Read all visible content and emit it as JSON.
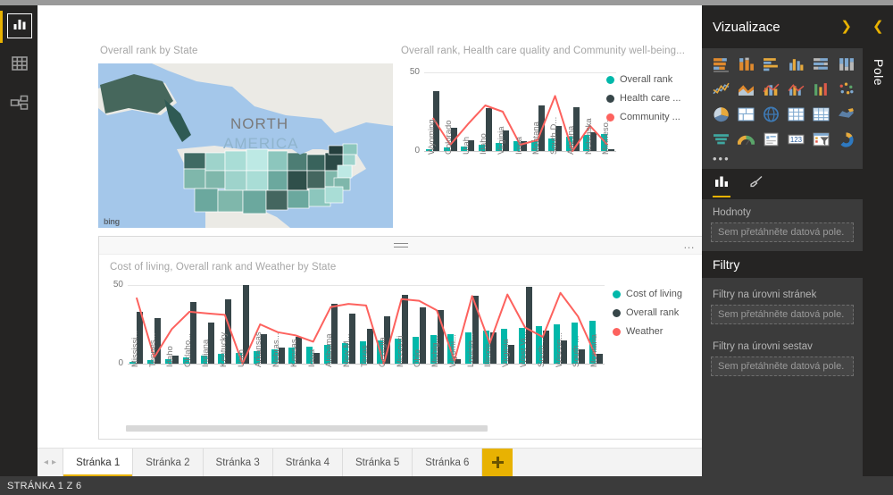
{
  "app": {
    "left_rail": [
      {
        "name": "report-view",
        "icon": "bar-chart-icon",
        "active": true
      },
      {
        "name": "data-view",
        "icon": "table-icon",
        "active": false
      },
      {
        "name": "model-view",
        "icon": "relationships-icon",
        "active": false
      }
    ]
  },
  "map_visual": {
    "title": "Overall rank by State",
    "attribution": "bing",
    "region_label_1": "NORTH",
    "region_label_2": "AMERICA"
  },
  "combo_top": {
    "title": "Overall rank, Health care quality and Community well-being...",
    "legend": [
      {
        "label": "Overall rank",
        "color": "#01b8aa"
      },
      {
        "label": "Health care ...",
        "color": "#374649"
      },
      {
        "label": "Community ...",
        "color": "#fd625e"
      }
    ]
  },
  "combo_bottom": {
    "title": "Cost of living, Overall rank and Weather by State",
    "legend": [
      {
        "label": "Cost of living",
        "color": "#01b8aa"
      },
      {
        "label": "Overall rank",
        "color": "#374649"
      },
      {
        "label": "Weather",
        "color": "#fd625e"
      }
    ],
    "more_options": "…",
    "scroll_position_pct": 0
  },
  "visualizations_pane": {
    "title": "Vizualizace",
    "collapse_icon": "chevron-right-icon",
    "more_visuals": "•••",
    "icons": [
      "stacked-bar-chart-icon",
      "stacked-column-chart-icon",
      "clustered-bar-chart-icon",
      "clustered-column-chart-icon",
      "hundred-percent-stacked-bar-chart-icon",
      "hundred-percent-stacked-column-chart-icon",
      "line-chart-icon",
      "area-chart-icon",
      "line-stacked-column-chart-icon",
      "line-clustered-column-chart-icon",
      "ribbon-chart-icon",
      "scatter-chart-icon",
      "pie-chart-icon",
      "treemap-icon",
      "map-icon",
      "table-icon",
      "matrix-icon",
      "filled-map-icon",
      "funnel-chart-icon",
      "gauge-icon",
      "card-icon",
      "multi-row-card-icon",
      "slicer-icon",
      "donut-chart-icon"
    ],
    "tabs": [
      {
        "name": "fields-tab",
        "icon": "fields-bar-icon",
        "active": true
      },
      {
        "name": "format-tab",
        "icon": "paint-brush-icon",
        "active": false
      }
    ],
    "values_label": "Hodnoty",
    "values_dropzone": "Sem přetáhněte datová pole."
  },
  "filters_pane": {
    "title": "Filtry",
    "page_level_label": "Filtry na úrovni stránek",
    "page_level_dropzone": "Sem přetáhněte datová pole.",
    "report_level_label": "Filtry na úrovni sestav",
    "report_level_dropzone": "Sem přetáhněte datová pole."
  },
  "fields_pane": {
    "title": "Pole",
    "collapse_icon": "chevron-left-icon"
  },
  "page_tabs": {
    "prev_icon": "◂",
    "next_icon": "▸",
    "tabs": [
      {
        "label": "Stránka 1",
        "active": true
      },
      {
        "label": "Stránka 2",
        "active": false
      },
      {
        "label": "Stránka 3",
        "active": false
      },
      {
        "label": "Stránka 4",
        "active": false
      },
      {
        "label": "Stránka 5",
        "active": false
      },
      {
        "label": "Stránka 6",
        "active": false
      }
    ],
    "add_label": "+"
  },
  "statusbar": {
    "text": "STRÁNKA 1 Z 6"
  },
  "chart_data": [
    {
      "id": "combo_top",
      "type": "bar",
      "title": "Overall rank, Health care quality and Community well-being...",
      "xlabel": "",
      "ylabel": "",
      "ylim": [
        0,
        50
      ],
      "yticks": [
        0,
        50
      ],
      "grid": true,
      "legend_position": "right",
      "categories": [
        "Wyoming",
        "Colorado",
        "Utah",
        "Idaho",
        "Virginia",
        "Iowa",
        "Montana",
        "South D...",
        "Arizona",
        "Nebraska",
        "Minneso..."
      ],
      "series": [
        {
          "name": "Overall rank",
          "kind": "bar",
          "color": "#01b8aa",
          "values": [
            1,
            2,
            3,
            4,
            5,
            6,
            7,
            8,
            9,
            10,
            11
          ]
        },
        {
          "name": "Health care ...",
          "kind": "bar",
          "color": "#374649",
          "values": [
            38,
            15,
            7,
            27,
            13,
            6,
            29,
            16,
            28,
            12,
            1
          ]
        },
        {
          "name": "Community ...",
          "kind": "line",
          "color": "#fd625e",
          "values": [
            21,
            4,
            17,
            29,
            25,
            4,
            7,
            35,
            0,
            16,
            4
          ]
        }
      ]
    },
    {
      "id": "combo_bottom",
      "type": "bar",
      "title": "Cost of living, Overall rank and Weather by State",
      "xlabel": "",
      "ylabel": "",
      "ylim": [
        0,
        50
      ],
      "yticks": [
        0,
        50
      ],
      "grid": true,
      "legend_position": "right",
      "categories": [
        "Mississi...",
        "Tennes...",
        "Idaho",
        "Oklaho...",
        "Indiana",
        "Kentucky",
        "Utah",
        "Arkansas",
        "Nebras...",
        "Kansas",
        "Iowa",
        "Alabama",
        "New M...",
        "Texas",
        "Georgia",
        "Missouri",
        "Ohio",
        "Michig...",
        "Wyomi...",
        "Louisia...",
        "Illinois",
        "Virginia",
        "West Vi...",
        "South ...",
        "Wiscon...",
        "South ...",
        "Montana"
      ],
      "series": [
        {
          "name": "Cost of living",
          "kind": "bar",
          "color": "#01b8aa",
          "values": [
            1,
            2,
            3,
            4,
            5,
            6,
            7,
            8,
            9,
            10,
            11,
            12,
            13,
            14,
            15,
            16,
            17,
            18,
            19,
            20,
            21,
            22,
            23,
            24,
            25,
            26,
            27
          ]
        },
        {
          "name": "Overall rank",
          "kind": "bar",
          "color": "#374649",
          "values": [
            33,
            29,
            5,
            39,
            26,
            41,
            50,
            19,
            10,
            17,
            7,
            38,
            32,
            22,
            30,
            44,
            36,
            34,
            3,
            43,
            20,
            12,
            49,
            21,
            15,
            9,
            6
          ]
        },
        {
          "name": "Weather",
          "kind": "line",
          "color": "#fd625e",
          "values": [
            42,
            4,
            22,
            33,
            32,
            31,
            0,
            25,
            20,
            18,
            14,
            36,
            38,
            37,
            0,
            41,
            40,
            34,
            2,
            43,
            13,
            44,
            23,
            17,
            45,
            30,
            5
          ]
        }
      ]
    }
  ]
}
